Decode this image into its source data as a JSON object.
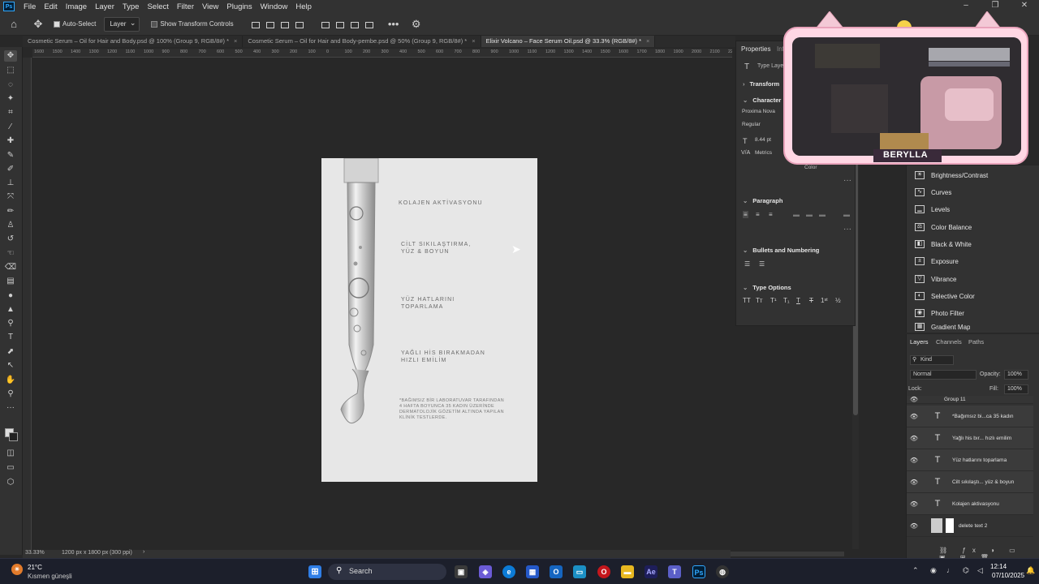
{
  "menu": [
    "File",
    "Edit",
    "Image",
    "Layer",
    "Type",
    "Select",
    "Filter",
    "View",
    "Plugins",
    "Window",
    "Help"
  ],
  "options": {
    "auto_select": "Auto-Select",
    "layer_select": "Layer",
    "transform_controls": "Show Transform Controls"
  },
  "tabs": [
    {
      "label": "Cosmetic Serum – Oil for Hair and Body.psd @ 100% (Group 9, RGB/8#) *"
    },
    {
      "label": "Cosmetic Serum – Oil for Hair and Body-pembe.psd @ 50% (Group 9, RGB/8#) *"
    },
    {
      "label": "Elixir Volcano – Face Serum Oil.psd @ 33.3% (RGB/8#) *"
    }
  ],
  "ruler_ticks": [
    "1600",
    "1500",
    "1400",
    "1300",
    "1200",
    "1100",
    "1000",
    "900",
    "800",
    "700",
    "600",
    "500",
    "400",
    "300",
    "200",
    "100",
    "0",
    "100",
    "200",
    "300",
    "400",
    "500",
    "600",
    "700",
    "800",
    "900",
    "1000",
    "1100",
    "1200",
    "1300",
    "1400",
    "1500",
    "1600",
    "1700",
    "1800",
    "1900",
    "2000",
    "2100",
    "2200"
  ],
  "document": {
    "line1": "KOLAJEN AKTİVASYONU",
    "line2": "CİLT SIKILAŞTIRMA,\nYÜZ & BOYUN",
    "line3": "YÜZ HATLARINI\nTOPARLAMA",
    "line4": "YAĞLI HİS BIRAKMADAN\nHIZLI EMİLİM",
    "footnote": "*BAĞIMSIZ BİR LABORATUVAR TARAFINDAN\n4 HAFTA BOYUNCA 35 KADIN ÜZERİNDE\nDERMATOLOJİK GÖZETİM ALTINDA YAPILAN\nKLİNİK TESTLERDE."
  },
  "status": {
    "zoom": "33.33%",
    "doc_size": "1200 px x 1800 px (300 ppi)"
  },
  "properties": {
    "tab": "Properties",
    "tab2": "Inf",
    "type_layer": "Type Layer",
    "transform": "Transform",
    "character": "Character",
    "font": "Proxima Nova",
    "style": "Regular",
    "size": "8.44 pt",
    "kerning": "Metrics",
    "color_label": "Color",
    "paragraph": "Paragraph",
    "bullets": "Bullets and Numbering",
    "type_options": "Type Options"
  },
  "adjustments": [
    "Brightness/Contrast",
    "Curves",
    "Levels",
    "Color Balance",
    "Black & White",
    "Exposure",
    "Vibrance",
    "Selective Color",
    "Photo Filter",
    "Gradient Map"
  ],
  "layers_panel": {
    "tabs": [
      "Layers",
      "Channels",
      "Paths"
    ],
    "kind": "Kind",
    "blend": "Normal",
    "opacity_label": "Opacity:",
    "opacity": "100%",
    "lock_label": "Lock:",
    "fill_label": "Fill:",
    "fill": "100%",
    "group_label": "Group 11",
    "rows": [
      "*Bağımsız bi...ca 35 kadın",
      "Yağlı his bır... hızlı emilim",
      "Yüz hatlarını  toparlama",
      "Cilt sıkılaştı...  yüz & boyun",
      "Kolajen aktivasyonu",
      "delete text 2"
    ]
  },
  "webcam": {
    "name": "BERYLLA"
  },
  "taskbar": {
    "weather_temp": "21°C",
    "weather_desc": "Kısmen güneşli",
    "search": "Search",
    "time": "12:14",
    "date": "07/10/2025"
  }
}
